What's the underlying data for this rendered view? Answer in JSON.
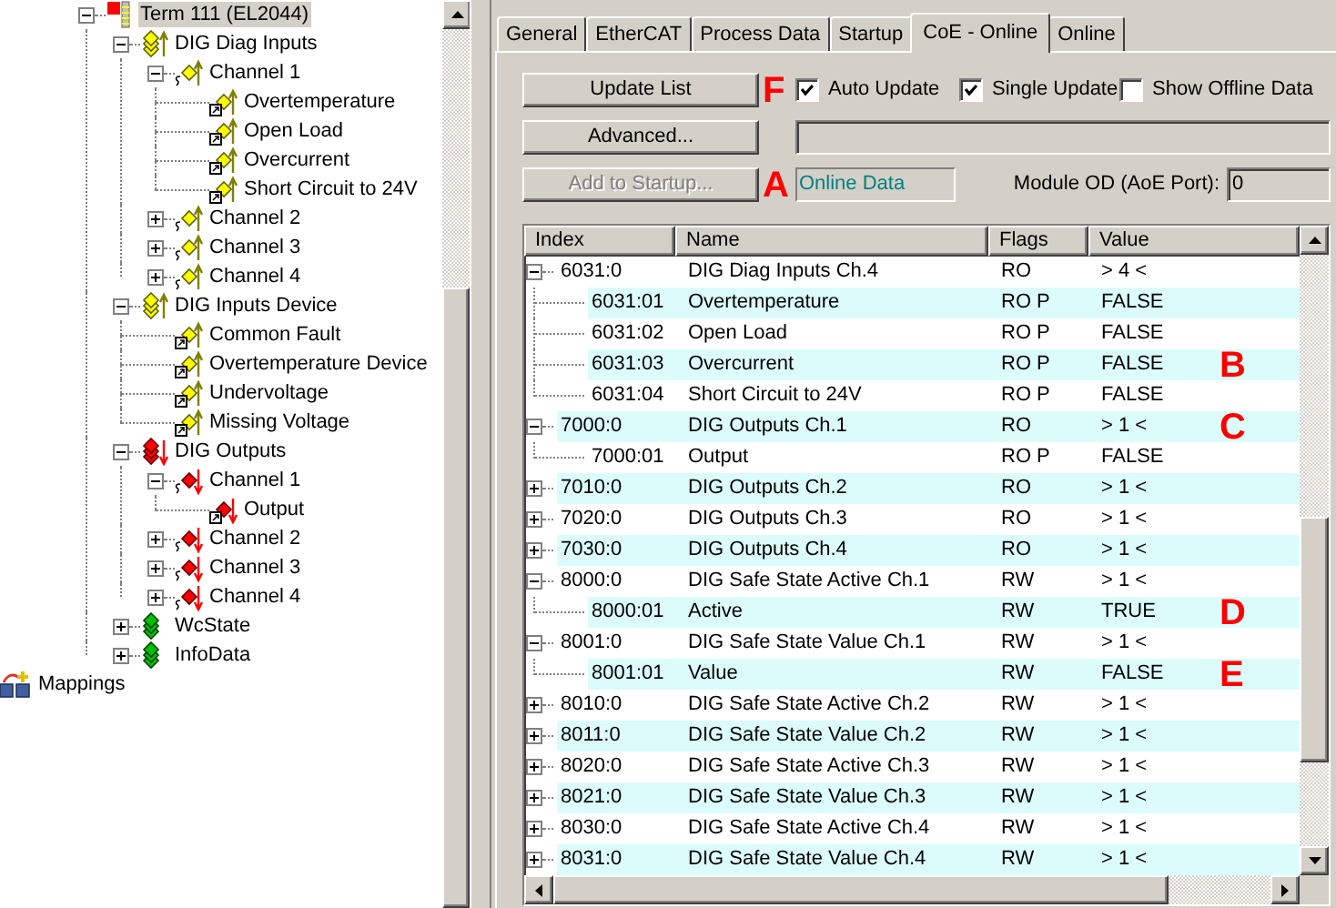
{
  "tree": {
    "nodes": [
      {
        "label": "Term 111 (EL2044)",
        "kind": "terminal",
        "expanded": true,
        "selected": true,
        "children": [
          {
            "label": "DIG Diag Inputs",
            "kind": "input-group",
            "expanded": true,
            "selected": false,
            "children": [
              {
                "label": "Channel 1",
                "kind": "input-channel",
                "expanded": true,
                "selected": false,
                "children": [
                  {
                    "label": "Overtemperature",
                    "kind": "input-var",
                    "selected": false
                  },
                  {
                    "label": "Open Load",
                    "kind": "input-var",
                    "selected": false
                  },
                  {
                    "label": "Overcurrent",
                    "kind": "input-var",
                    "selected": false
                  },
                  {
                    "label": "Short Circuit to 24V",
                    "kind": "input-var",
                    "selected": false
                  }
                ]
              },
              {
                "label": "Channel 2",
                "kind": "input-channel",
                "expanded": false,
                "selected": false
              },
              {
                "label": "Channel 3",
                "kind": "input-channel",
                "expanded": false,
                "selected": false
              },
              {
                "label": "Channel 4",
                "kind": "input-channel",
                "expanded": false,
                "selected": false
              }
            ]
          },
          {
            "label": "DIG Inputs Device",
            "kind": "input-group",
            "expanded": true,
            "selected": false,
            "children": [
              {
                "label": "Common Fault",
                "kind": "input-var",
                "selected": false
              },
              {
                "label": "Overtemperature Device",
                "kind": "input-var",
                "selected": false
              },
              {
                "label": "Undervoltage",
                "kind": "input-var",
                "selected": false
              },
              {
                "label": "Missing Voltage",
                "kind": "input-var",
                "selected": false
              }
            ]
          },
          {
            "label": "DIG Outputs",
            "kind": "output-group",
            "expanded": true,
            "selected": false,
            "children": [
              {
                "label": "Channel 1",
                "kind": "output-channel",
                "expanded": true,
                "selected": false,
                "children": [
                  {
                    "label": "Output",
                    "kind": "output-var",
                    "selected": false
                  }
                ]
              },
              {
                "label": "Channel 2",
                "kind": "output-channel",
                "expanded": false,
                "selected": false
              },
              {
                "label": "Channel 3",
                "kind": "output-channel",
                "expanded": false,
                "selected": false
              },
              {
                "label": "Channel 4",
                "kind": "output-channel",
                "expanded": false,
                "selected": false
              }
            ]
          },
          {
            "label": "WcState",
            "kind": "status-group",
            "expanded": false,
            "selected": false
          },
          {
            "label": "InfoData",
            "kind": "status-group",
            "expanded": false,
            "selected": false
          }
        ]
      }
    ],
    "footer_item": {
      "label": "Mappings",
      "kind": "mappings",
      "selected": false
    }
  },
  "tabs": [
    {
      "label": "General",
      "selected": false
    },
    {
      "label": "EtherCAT",
      "selected": false
    },
    {
      "label": "Process Data",
      "selected": false
    },
    {
      "label": "Startup",
      "selected": false
    },
    {
      "label": "CoE - Online",
      "selected": true
    },
    {
      "label": "Online",
      "selected": false
    }
  ],
  "buttons": [
    {
      "label": "Update List",
      "disabled": false
    },
    {
      "label": "Advanced...",
      "disabled": false
    },
    {
      "label": "Add to Startup...",
      "disabled": true
    }
  ],
  "annotations": [
    {
      "label": "F"
    },
    {
      "label": "A"
    }
  ],
  "checkboxes": [
    {
      "label": "Auto Update",
      "checked": true
    },
    {
      "label": "Single Update",
      "checked": true
    },
    {
      "label": "Show Offline Data",
      "checked": false
    }
  ],
  "status_field": {
    "value": "Online Data"
  },
  "module_od": {
    "label": "Module OD (AoE Port):",
    "value": "0"
  },
  "table": {
    "columns": [
      "Index",
      "Name",
      "Flags",
      "Value"
    ],
    "rows": [
      {
        "kind": "object",
        "expanded": true,
        "index": "6031:0",
        "name": "DIG Diag Inputs Ch.4",
        "flags": "RO",
        "value": "> 4 <"
      },
      {
        "kind": "entry",
        "index": "6031:01",
        "name": "Overtemperature",
        "flags": "RO P",
        "value": "FALSE"
      },
      {
        "kind": "entry",
        "index": "6031:02",
        "name": "Open Load",
        "flags": "RO P",
        "value": "FALSE"
      },
      {
        "kind": "entry",
        "index": "6031:03",
        "name": "Overcurrent",
        "flags": "RO P",
        "value": "FALSE",
        "annotation": "B"
      },
      {
        "kind": "entry",
        "index": "6031:04",
        "name": "Short Circuit to 24V",
        "flags": "RO P",
        "value": "FALSE"
      },
      {
        "kind": "object",
        "expanded": true,
        "index": "7000:0",
        "name": "DIG Outputs Ch.1",
        "flags": "RO",
        "value": "> 1 <",
        "annotation": "C"
      },
      {
        "kind": "entry",
        "index": "7000:01",
        "name": "Output",
        "flags": "RO P",
        "value": "FALSE"
      },
      {
        "kind": "object",
        "expanded": false,
        "index": "7010:0",
        "name": "DIG Outputs Ch.2",
        "flags": "RO",
        "value": "> 1 <"
      },
      {
        "kind": "object",
        "expanded": false,
        "index": "7020:0",
        "name": "DIG Outputs Ch.3",
        "flags": "RO",
        "value": "> 1 <"
      },
      {
        "kind": "object",
        "expanded": false,
        "index": "7030:0",
        "name": "DIG Outputs Ch.4",
        "flags": "RO",
        "value": "> 1 <"
      },
      {
        "kind": "object",
        "expanded": true,
        "index": "8000:0",
        "name": "DIG Safe State Active Ch.1",
        "flags": "RW",
        "value": "> 1 <"
      },
      {
        "kind": "entry",
        "index": "8000:01",
        "name": "Active",
        "flags": "RW",
        "value": "TRUE",
        "annotation": "D"
      },
      {
        "kind": "object",
        "expanded": true,
        "index": "8001:0",
        "name": "DIG Safe State Value Ch.1",
        "flags": "RW",
        "value": "> 1 <"
      },
      {
        "kind": "entry",
        "index": "8001:01",
        "name": "Value",
        "flags": "RW",
        "value": "FALSE",
        "annotation": "E"
      },
      {
        "kind": "object",
        "expanded": false,
        "index": "8010:0",
        "name": "DIG Safe State Active Ch.2",
        "flags": "RW",
        "value": "> 1 <"
      },
      {
        "kind": "object",
        "expanded": false,
        "index": "8011:0",
        "name": "DIG Safe State Value Ch.2",
        "flags": "RW",
        "value": "> 1 <"
      },
      {
        "kind": "object",
        "expanded": false,
        "index": "8020:0",
        "name": "DIG Safe State Active Ch.3",
        "flags": "RW",
        "value": "> 1 <"
      },
      {
        "kind": "object",
        "expanded": false,
        "index": "8021:0",
        "name": "DIG Safe State Value Ch.3",
        "flags": "RW",
        "value": "> 1 <"
      },
      {
        "kind": "object",
        "expanded": false,
        "index": "8030:0",
        "name": "DIG Safe State Active Ch.4",
        "flags": "RW",
        "value": "> 1 <"
      },
      {
        "kind": "object",
        "expanded": false,
        "index": "8031:0",
        "name": "DIG Safe State Value Ch.4",
        "flags": "RW",
        "value": "> 1 <"
      }
    ]
  }
}
